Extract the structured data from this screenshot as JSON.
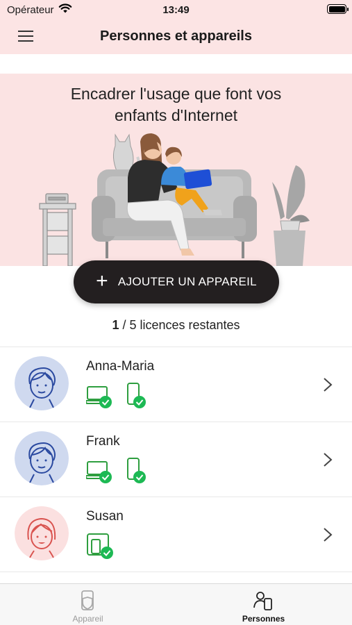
{
  "status_bar": {
    "carrier": "Opérateur",
    "time": "13:49"
  },
  "header": {
    "title": "Personnes et appareils"
  },
  "hero": {
    "title_line1": "Encadrer l'usage que font vos",
    "title_line2": "enfants d'Internet"
  },
  "add_device": {
    "icon": "+",
    "label": "AJOUTER UN APPAREIL"
  },
  "licences": {
    "count": "1",
    "text": " / 5 licences restantes"
  },
  "people": [
    {
      "name": "Anna-Maria",
      "avatar": "boy-avatar-icon",
      "devices": [
        "laptop",
        "phone"
      ]
    },
    {
      "name": "Frank",
      "avatar": "boy-avatar-icon",
      "devices": [
        "laptop",
        "phone"
      ]
    },
    {
      "name": "Susan",
      "avatar": "girl-avatar-icon",
      "devices": [
        "tablet"
      ]
    }
  ],
  "tabs": [
    {
      "label": "Appareil",
      "icon": "device-shield-icon",
      "active": false
    },
    {
      "label": "Personnes",
      "icon": "people-devices-icon",
      "active": true
    }
  ],
  "colors": {
    "accent_green": "#1db954",
    "device_green": "#2e9e3f",
    "button_dark": "#231f20",
    "hero_bg": "#fbe3e3",
    "boy_avatar_bg": "#cfd9ef",
    "girl_avatar_bg": "#fbe0e0"
  }
}
